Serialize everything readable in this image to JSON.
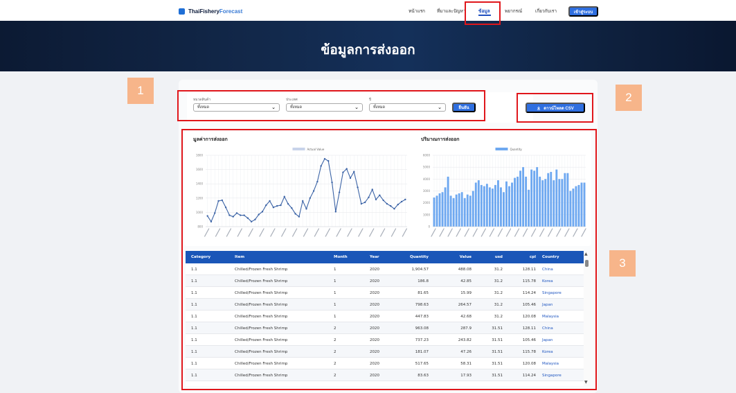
{
  "nav": {
    "logo_main": "ThaiFishery",
    "logo_accent": "Forecast",
    "links": [
      "หน้าแรก",
      "ที่มาและปัญหา",
      "ข้อมูล",
      "พยากรณ์",
      "เกี่ยวกับเรา"
    ],
    "active_link": "ข้อมูล",
    "login_label": "เข้าสู่ระบบ",
    "accent_color": "#2f6fe0"
  },
  "hero": {
    "title": "ข้อมูลการส่งออก"
  },
  "filters": {
    "category_label": "หมวดสินค้า",
    "category_value": "ทั้งหมด",
    "country_label": "ประเทศ",
    "country_value": "ทั้งหมด",
    "year_label": "ปี",
    "year_value": "ทั้งหมด",
    "confirm_label": "ยืนยัน",
    "download_label": "ดาวน์โหลด CSV"
  },
  "chart_data": [
    {
      "type": "line",
      "title": "มูลค่าการส่งออก",
      "legend": "Actual Value",
      "legend_position": "top",
      "ylim": [
        800,
        1800
      ],
      "yticks": [
        800,
        1000,
        1200,
        1400,
        1600,
        1800
      ],
      "grid": true,
      "color": "#3b63a6",
      "values": [
        950,
        870,
        990,
        1160,
        1170,
        1070,
        960,
        940,
        990,
        960,
        960,
        920,
        870,
        900,
        970,
        1010,
        1100,
        1160,
        1070,
        1090,
        1100,
        1220,
        1120,
        1060,
        980,
        940,
        1160,
        1050,
        1200,
        1300,
        1430,
        1650,
        1750,
        1720,
        1420,
        1010,
        1280,
        1560,
        1610,
        1480,
        1570,
        1350,
        1120,
        1140,
        1210,
        1320,
        1180,
        1240,
        1170,
        1120,
        1090,
        1050,
        1110,
        1150,
        1180
      ]
    },
    {
      "type": "bar",
      "title": "ปริมาณการส่งออก",
      "legend": "Quantity",
      "legend_position": "top",
      "ylim": [
        0,
        6000
      ],
      "yticks": [
        0,
        1000,
        2000,
        3000,
        4000,
        5000,
        6000
      ],
      "grid": true,
      "color": "#6ea8f0",
      "values": [
        2450,
        2600,
        2800,
        2900,
        3300,
        4200,
        2600,
        2400,
        2700,
        2800,
        2900,
        2400,
        2700,
        2600,
        3000,
        3700,
        3900,
        3500,
        3400,
        3600,
        3300,
        3200,
        3500,
        3900,
        3300,
        2900,
        3800,
        3400,
        3700,
        4100,
        4200,
        4700,
        5000,
        4200,
        3100,
        4800,
        4700,
        5000,
        4200,
        3900,
        4000,
        4500,
        4600,
        3900,
        4800,
        4000,
        4000,
        4500,
        4500,
        3000,
        3200,
        3400,
        3500,
        3700,
        3700
      ]
    }
  ],
  "table": {
    "columns": [
      "Category",
      "Item",
      "Month",
      "Year",
      "Quantity",
      "Value",
      "usd",
      "cpl",
      "Country"
    ],
    "rows": [
      [
        "1.1",
        "Chilled/Frozen Fresh Shrimp",
        "1",
        "2020",
        "1,904.57",
        "488.08",
        "31.2",
        "128.11",
        "China"
      ],
      [
        "1.1",
        "Chilled/Frozen Fresh Shrimp",
        "1",
        "2020",
        "186.8",
        "42.85",
        "31.2",
        "115.78",
        "Korea"
      ],
      [
        "1.1",
        "Chilled/Frozen Fresh Shrimp",
        "1",
        "2020",
        "81.65",
        "15.99",
        "31.2",
        "114.24",
        "Singapore"
      ],
      [
        "1.1",
        "Chilled/Frozen Fresh Shrimp",
        "1",
        "2020",
        "798.63",
        "264.57",
        "31.2",
        "105.46",
        "Japan"
      ],
      [
        "1.1",
        "Chilled/Frozen Fresh Shrimp",
        "1",
        "2020",
        "447.83",
        "42.68",
        "31.2",
        "120.08",
        "Malaysia"
      ],
      [
        "1.1",
        "Chilled/Frozen Fresh Shrimp",
        "2",
        "2020",
        "963.08",
        "287.9",
        "31.51",
        "128.11",
        "China"
      ],
      [
        "1.1",
        "Chilled/Frozen Fresh Shrimp",
        "2",
        "2020",
        "737.23",
        "243.82",
        "31.51",
        "105.46",
        "Japan"
      ],
      [
        "1.1",
        "Chilled/Frozen Fresh Shrimp",
        "2",
        "2020",
        "181.07",
        "47.26",
        "31.51",
        "115.78",
        "Korea"
      ],
      [
        "1.1",
        "Chilled/Frozen Fresh Shrimp",
        "2",
        "2020",
        "517.65",
        "58.31",
        "31.51",
        "120.08",
        "Malaysia"
      ],
      [
        "1.1",
        "Chilled/Frozen Fresh Shrimp",
        "2",
        "2020",
        "83.63",
        "17.93",
        "31.51",
        "114.24",
        "Singapore"
      ]
    ]
  },
  "annotations": {
    "tag_color": "#f7b58a",
    "box_color": "#e0161b",
    "labels": [
      "1",
      "2",
      "3"
    ]
  }
}
